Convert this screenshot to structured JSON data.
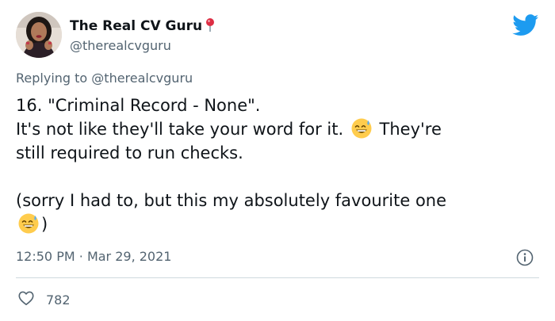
{
  "author": {
    "name": "The Real CV Guru",
    "handle": "@therealcvguru"
  },
  "reply": {
    "prefix": "Replying to",
    "mention": "@therealcvguru"
  },
  "tweet": {
    "line1": "16. \"Criminal Record - None\".",
    "line2a": "It's not like they'll take your word for it.",
    "line2b": "They're",
    "line3": "still required to run checks.",
    "line4": "(sorry I had to, but this my absolutely favourite one",
    "line5": ")"
  },
  "meta": {
    "time": "12:50 PM",
    "separator": "·",
    "date": "Mar 29, 2021"
  },
  "stats": {
    "likes": "782"
  },
  "icons": {
    "verified_pin": "round-pushpin-icon",
    "brand": "twitter-bird-icon",
    "emoji": "sweat-smile-emoji",
    "info": "info-icon",
    "like": "heart-icon"
  },
  "colors": {
    "brand_blue": "#1d9bf0",
    "muted_text": "#536471",
    "primary_text": "#0f1419",
    "divider": "#cfd9de",
    "pin_red": "#dd2e44"
  }
}
